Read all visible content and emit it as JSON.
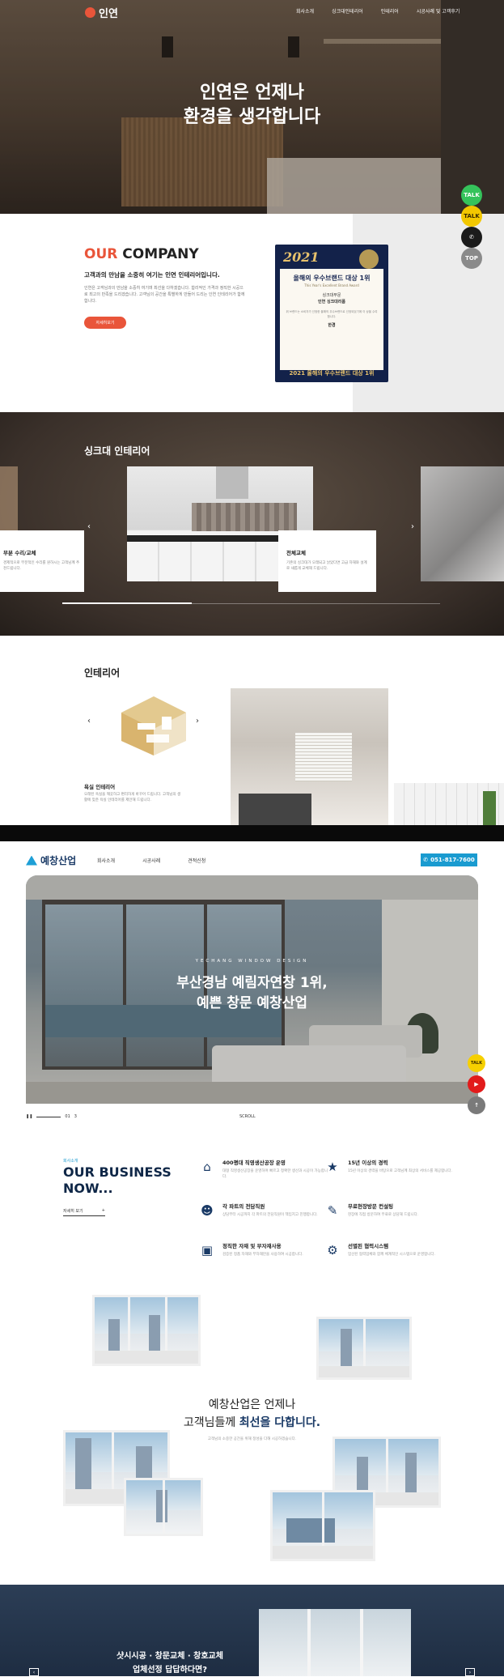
{
  "site1": {
    "logo": "인연",
    "nav": [
      "회사소개",
      "싱크대인테리어",
      "인테리어",
      "시공사례 및 고객후기"
    ],
    "hero_lines": [
      "인연은 언제나",
      "환경을 생각합니다"
    ],
    "quick_menu": [
      "TALK",
      "TALK",
      "",
      "TOP"
    ],
    "company": {
      "title_accent": "OUR",
      "title_rest": "COMPANY",
      "subtitle": "고객과의 만남을 소중히 여기는 인연 인테리어입니다.",
      "desc": "인연은 고객님과의 만남을 소중히 여기며 최선을 다하겠습니다. 합리적인 가격과 정직한 시공으로 최고의 만족을 드리겠습니다. 고객님의 공간을 특별하게 만들어 드리는 인연 인테리어가 함께합니다.",
      "button": "자세히보기",
      "award": {
        "year": "2021",
        "line1": "올해의 우수브랜드 대상 1위",
        "line2": "This Year's Excellent Brand Award",
        "line3": "싱크대부문",
        "line4": "인연 싱크대리폼",
        "line5": "위 브랜드는 소비자가 선정한 올해의 우수브랜드로 선정되었기에 이 상을 수여합니다.",
        "line6": "한경",
        "footer": "2021 올해의 우수브랜드 대상 1위"
      }
    },
    "sink": {
      "title": "싱크대 인테리어",
      "card_left": {
        "title": "부분 수리/교체",
        "desc": "경제적으로 부분적인 수리를 원하시는 고객님께 추천드립니다."
      },
      "card_right": {
        "title": "전체교체",
        "desc": "기존의 싱크대가 오래되고 낡았다면 고급 자재와 설계로 새롭게 교체해 드립니다."
      }
    },
    "interior": {
      "title": "인테리어",
      "label": "욕실 인테리어",
      "desc": "오래된 욕실을 깨끗하고 편리하게 바꾸어 드립니다. 고객님의 생활에 맞춘 욕실 인테리어를 제안해 드립니다."
    }
  },
  "site2": {
    "logo": "예창산업",
    "nav": [
      "회사소개",
      "시공사례",
      "견적신청"
    ],
    "phone": "051-817-7600",
    "hero_sub": "YECHANG WINDOW DESIGN",
    "hero_lines": [
      "부산경남 예림자연창 1위,",
      "예쁜 창문 예창산업"
    ],
    "pager": "01",
    "pager_total": "3",
    "scroll": "SCROLL",
    "side_icons": [
      "TALK",
      "▶",
      "↑"
    ],
    "business": {
      "small": "회사소개",
      "title_lines": [
        "OUR BUSINESS",
        "NOW..."
      ],
      "more": "자세히 보기",
      "items": [
        {
          "icon": "home-icon",
          "title": "400평대 직영생산공장 운영",
          "desc": "대형 직영생산공장을 운영하며 빠르고 정확한 생산과 시공이 가능합니다."
        },
        {
          "icon": "star-icon",
          "title": "15년 이상의 경력",
          "desc": "15년 이상의 경력을 바탕으로 고객님께 최상의 서비스를 제공합니다."
        },
        {
          "icon": "people-icon",
          "title": "각 파트의 전담직원",
          "desc": "상담부터 시공까지 각 파트의 전담직원이 책임지고 진행합니다."
        },
        {
          "icon": "pen-icon",
          "title": "무료현장방문 컨설팅",
          "desc": "현장에 직접 방문하여 무료로 상담해 드립니다."
        },
        {
          "icon": "box-icon",
          "title": "정직한 자재 및 부자재사용",
          "desc": "검증된 정품 자재와 부자재만을 사용하여 시공합니다."
        },
        {
          "icon": "gear-icon",
          "title": "선별된 협력시스템",
          "desc": "엄선된 협력업체와 함께 체계적인 시스템으로 운영합니다."
        }
      ]
    },
    "gallery": {
      "title_line1": "예창산업은 언제나",
      "title_line2_pre": "고객님들께 ",
      "title_line2_em": "최선을 다합니다.",
      "desc": "고객님의 소중한 공간을 위해 정성을 다해 시공하겠습니다."
    },
    "bottom": {
      "lines": [
        "샷시시공 · 창문교체 · 창호교체",
        "업체선정 답답하다면?"
      ]
    }
  }
}
